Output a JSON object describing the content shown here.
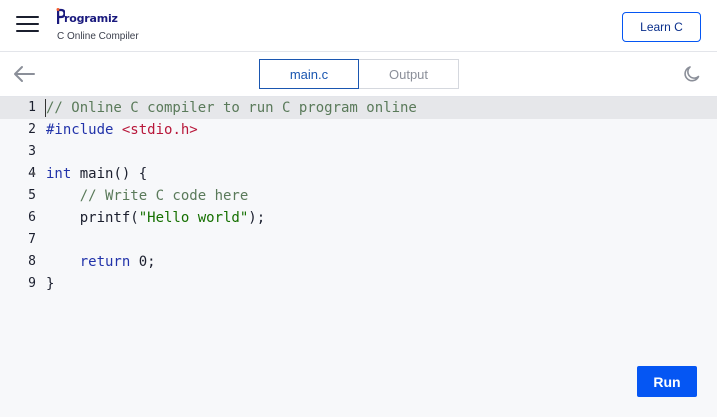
{
  "header": {
    "logo_text": "rogramiz",
    "subtitle": "C Online Compiler",
    "learn_button": "Learn C",
    "menu_icon": "hamburger-menu-icon",
    "accent_color": "#0556f3"
  },
  "toolbar": {
    "back_icon": "arrow-left-icon",
    "theme_icon": "moon-icon",
    "tabs": [
      {
        "label": "main.c",
        "active": true
      },
      {
        "label": "Output",
        "active": false
      }
    ]
  },
  "editor": {
    "lines": [
      {
        "num": "1",
        "tokens": [
          {
            "t": "// Online C compiler to run C program online",
            "c": "comment"
          }
        ]
      },
      {
        "num": "2",
        "tokens": [
          {
            "t": "#include",
            "c": "directive"
          },
          {
            "t": " ",
            "c": "plain"
          },
          {
            "t": "<stdio.h>",
            "c": "header"
          }
        ]
      },
      {
        "num": "3",
        "tokens": []
      },
      {
        "num": "4",
        "fold": true,
        "tokens": [
          {
            "t": "int",
            "c": "keyword"
          },
          {
            "t": " main() {",
            "c": "plain"
          }
        ]
      },
      {
        "num": "5",
        "tokens": [
          {
            "t": "    // Write C code here",
            "c": "comment"
          }
        ]
      },
      {
        "num": "6",
        "tokens": [
          {
            "t": "    printf(",
            "c": "plain"
          },
          {
            "t": "\"Hello world\"",
            "c": "string"
          },
          {
            "t": ");",
            "c": "plain"
          }
        ]
      },
      {
        "num": "7",
        "tokens": []
      },
      {
        "num": "8",
        "tokens": [
          {
            "t": "    ",
            "c": "plain"
          },
          {
            "t": "return",
            "c": "keyword"
          },
          {
            "t": " 0;",
            "c": "plain"
          }
        ]
      },
      {
        "num": "9",
        "tokens": [
          {
            "t": "}",
            "c": "plain"
          }
        ]
      }
    ]
  },
  "run_button": "Run"
}
